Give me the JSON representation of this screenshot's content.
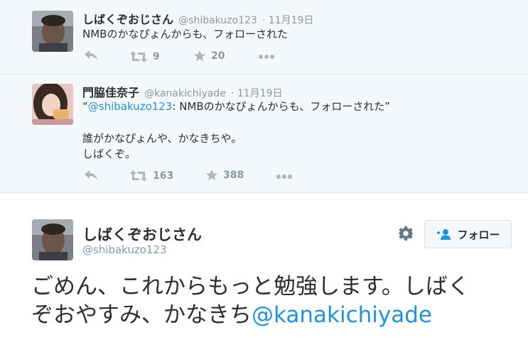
{
  "tweets": [
    {
      "display_name": "しばくぞおじさん",
      "handle": "@shibakuzo123",
      "date": "· 11月19日",
      "text": "NMBのかなぴょんからも、フォローされた",
      "retweets": "9",
      "favorites": "20"
    },
    {
      "display_name": "門脇佳奈子",
      "handle": "@kanakichiyade",
      "date": "· 11月19日",
      "quote_open": "“",
      "mention": "@shibakuzo123",
      "quote_rest": ": NMBのかなぴょんからも、フォローされた”",
      "line2": "誰がかなぴょんや、かなきちや。",
      "line3": "しばくぞ。",
      "retweets": "163",
      "favorites": "388"
    }
  ],
  "main_tweet": {
    "display_name": "しばくぞおじさん",
    "handle": "@shibakuzo123",
    "follow_label": "フォロー",
    "text_line1": "ごめん、これからもっと勉強します。しばく",
    "text_line2": "ぞおやすみ、かなきち",
    "mention": "@kanakichiyade"
  },
  "icons": {
    "reply": "reply-icon",
    "retweet": "retweet-icon",
    "favorite": "star-icon",
    "more": "more-icon",
    "settings": "gear-icon",
    "follow": "add-user-icon"
  },
  "colors": {
    "link": "#1b95e0",
    "muted": "#8899a6",
    "text": "#292f33",
    "thread_bg": "#f5f8fa"
  }
}
